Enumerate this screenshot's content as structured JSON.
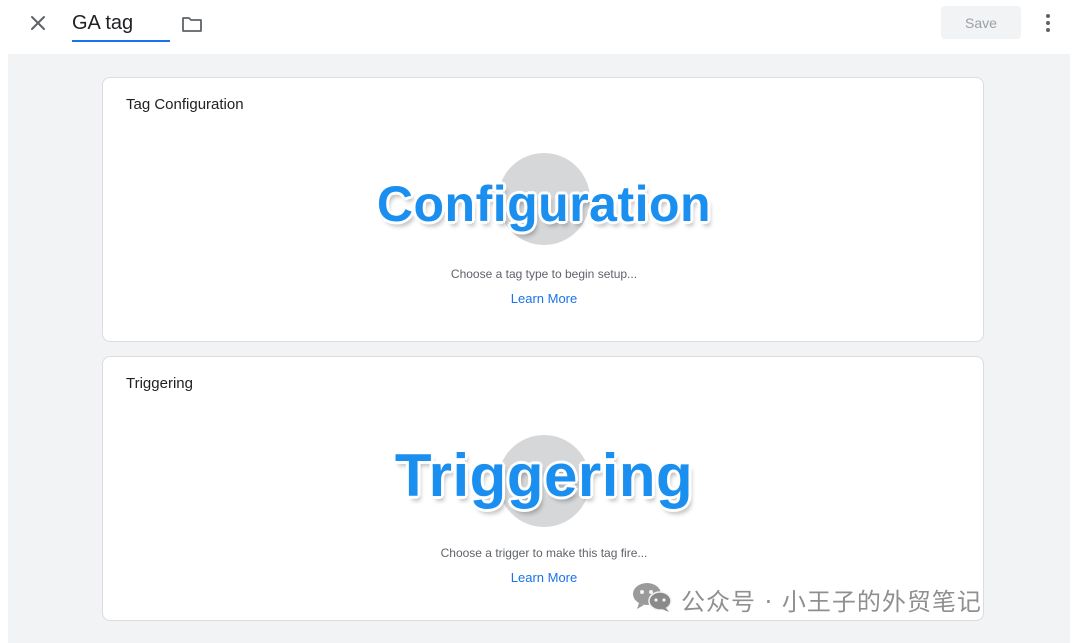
{
  "header": {
    "tag_name_value": "GA tag",
    "save_label": "Save",
    "icons": {
      "close": "close-icon",
      "folder": "folder-icon",
      "more": "more-vert-icon"
    }
  },
  "tag_configuration": {
    "title": "Tag Configuration",
    "illustration_label": "Configuration",
    "hint": "Choose a tag type to begin setup...",
    "learn_more": "Learn More"
  },
  "triggering": {
    "title": "Triggering",
    "illustration_label": "Triggering",
    "hint": "Choose a trigger to make this tag fire...",
    "learn_more": "Learn More"
  },
  "watermark": {
    "text": "公众号 · 小王子的外贸笔记",
    "icon": "wechat-icon"
  },
  "colors": {
    "accent": "#1a73e8",
    "illustration_text": "#1a8ff0",
    "canvas_bg": "#f1f3f4",
    "card_border": "#dadce0"
  }
}
